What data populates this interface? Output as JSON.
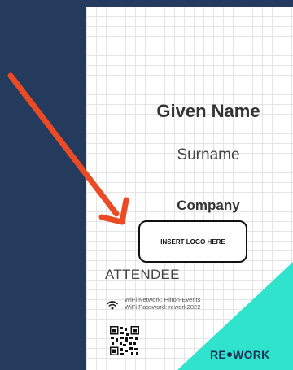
{
  "badge": {
    "given_name": "Given Name",
    "surname": "Surname",
    "company": "Company",
    "logo_placeholder": "INSERT LOGO HERE",
    "role": "ATTENDEE",
    "wifi": {
      "network_line": "WiFi Network: Hilton-Events",
      "password_line": "WiFi Password: rework2022"
    },
    "brand": {
      "part1": "RE",
      "part2": "WORK"
    }
  },
  "colors": {
    "background": "#253b5e",
    "arrow": "#ea4b25",
    "accent_teal": "#2fe3cd",
    "brand_navy": "#1e3158"
  },
  "icons": {
    "pointer": "arrow-icon",
    "wifi": "wifi-icon",
    "qr": "qr-code-icon"
  }
}
